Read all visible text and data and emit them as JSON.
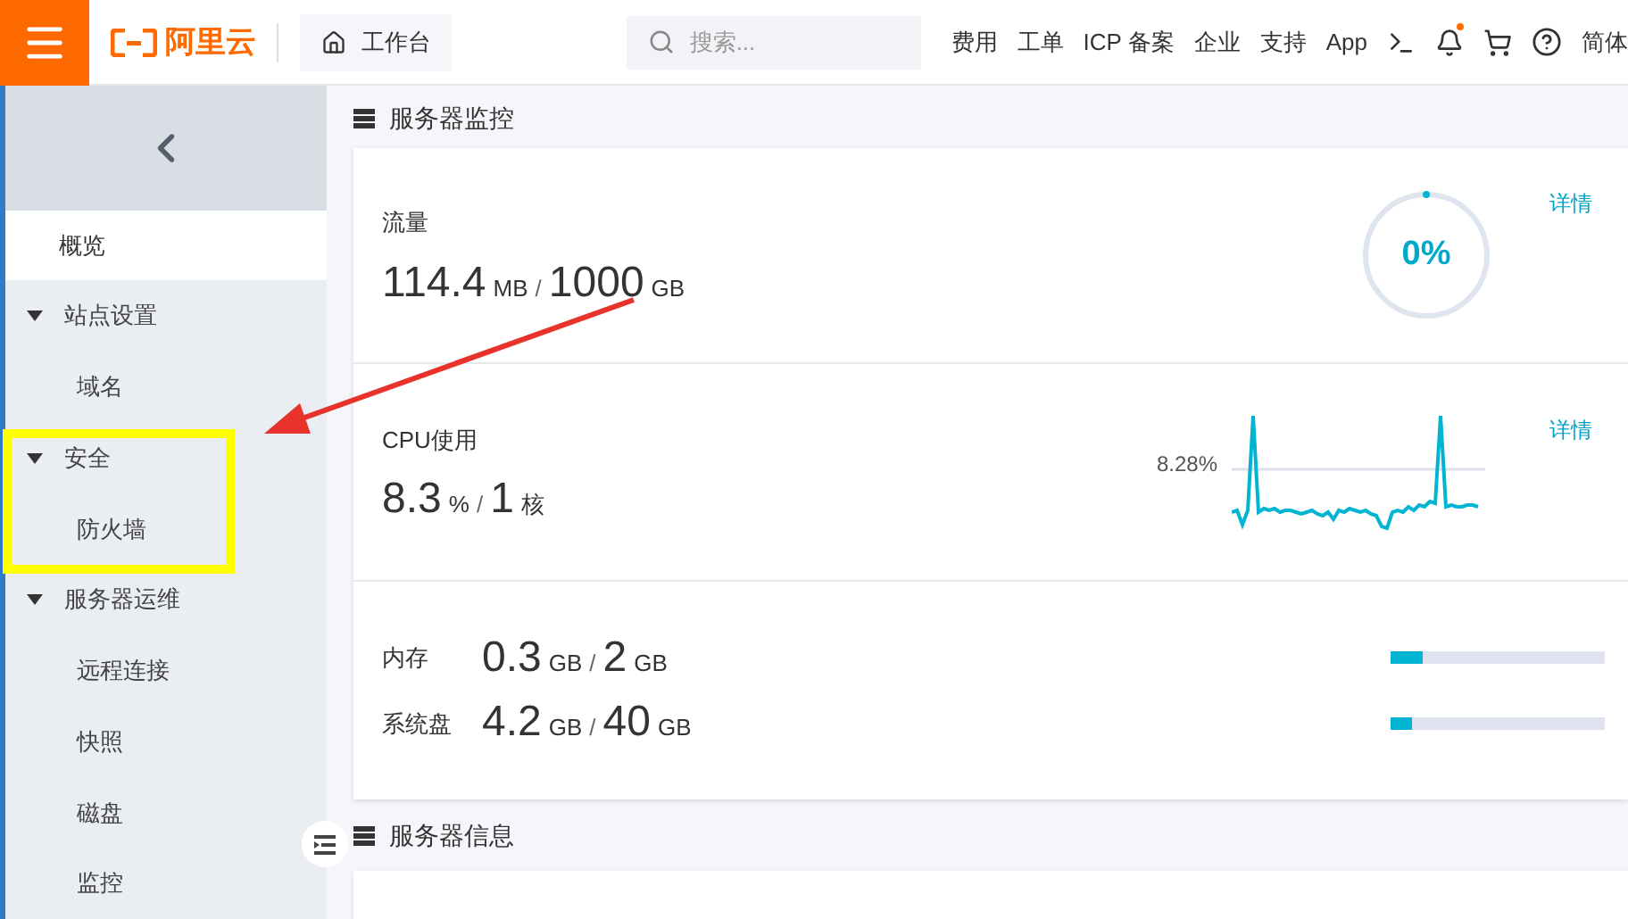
{
  "header": {
    "logo": "阿里云",
    "workbench": "工作台",
    "search": {
      "placeholder": "搜索..."
    },
    "links": [
      "费用",
      "工单",
      "ICP 备案",
      "企业",
      "支持",
      "App"
    ],
    "notification_dot": true,
    "language": "简体"
  },
  "sidebar": {
    "items": [
      {
        "label": "概览",
        "selected": true
      },
      {
        "label": "站点设置",
        "expanded": true,
        "children": [
          {
            "label": "域名",
            "selected": false
          }
        ]
      },
      {
        "label": "安全",
        "expanded": true,
        "children": [
          {
            "label": "防火墙",
            "selected": false
          }
        ]
      },
      {
        "label": "服务器运维",
        "expanded": true,
        "children": [
          {
            "label": "远程连接",
            "selected": false
          },
          {
            "label": "快照",
            "selected": false
          },
          {
            "label": "磁盘",
            "selected": false
          },
          {
            "label": "监控",
            "selected": false
          }
        ]
      }
    ]
  },
  "monitor": {
    "title": "服务器监控",
    "traffic": {
      "label": "流量",
      "used": "114.4",
      "used_unit": "MB",
      "separator": "/",
      "total": "1000",
      "total_unit": "GB",
      "gauge": {
        "reading": "0%"
      },
      "detail": "详情"
    },
    "cpu": {
      "label": "CPU使用",
      "used": "8.3",
      "used_unit": "%",
      "separator": "/",
      "total": "1",
      "total_unit": "核",
      "chart_reading": "8.28%",
      "detail": "详情"
    },
    "resources": [
      {
        "label": "内存",
        "used": "0.3",
        "used_unit": "GB",
        "separator": "/",
        "total": "2",
        "total_unit": "GB",
        "level": 0.15
      },
      {
        "label": "系统盘",
        "used": "4.2",
        "used_unit": "GB",
        "separator": "/",
        "total": "40",
        "total_unit": "GB",
        "level": 0.1
      }
    ]
  },
  "info": {
    "title": "服务器信息"
  }
}
